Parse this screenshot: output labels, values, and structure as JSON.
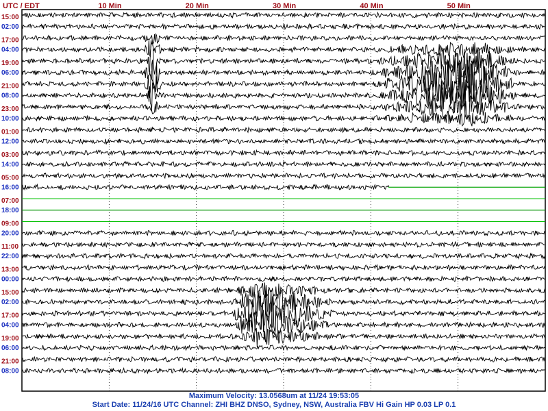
{
  "header": {
    "timezone_label": "UTC / EDT"
  },
  "footer": {
    "max_velocity": "Maximum Velocity: 13.0568um at 11/24 19:53:05",
    "start_info": "Start Date: 11/24/16 UTC Channel: ZHI  BHZ  DNSO, Sydney, NSW, Australia  FBV Hi Gain HP 0.03  LP 0.1"
  },
  "colors": {
    "utc_label": "#a0101a",
    "local_label": "#1a2fc0",
    "trace": "#000000",
    "quiet_trace": "#00c000",
    "grid": "#000000"
  },
  "chart_data": {
    "type": "line",
    "title": "",
    "xlabel": "",
    "ylabel": "",
    "x_unit": "Min",
    "xlim": [
      0,
      60
    ],
    "x_ticks": [
      {
        "value": 10,
        "label": "10 Min"
      },
      {
        "value": 20,
        "label": "20 Min"
      },
      {
        "value": 30,
        "label": "30 Min"
      },
      {
        "value": 40,
        "label": "40 Min"
      },
      {
        "value": 50,
        "label": "50 Min"
      }
    ],
    "rows_per_label": 2,
    "left_labels": [
      {
        "utc": "15:00",
        "local": "02:00"
      },
      {
        "utc": "17:00",
        "local": "04:00"
      },
      {
        "utc": "19:00",
        "local": "06:00"
      },
      {
        "utc": "21:00",
        "local": "08:00"
      },
      {
        "utc": "23:00",
        "local": "10:00"
      },
      {
        "utc": "01:00",
        "local": "12:00"
      },
      {
        "utc": "03:00",
        "local": "14:00"
      },
      {
        "utc": "05:00",
        "local": "16:00"
      },
      {
        "utc": "07:00",
        "local": "18:00"
      },
      {
        "utc": "09:00",
        "local": "20:00"
      },
      {
        "utc": "11:00",
        "local": "22:00"
      },
      {
        "utc": "13:00",
        "local": "00:00"
      },
      {
        "utc": "15:00",
        "local": "02:00"
      },
      {
        "utc": "17:00",
        "local": "04:00"
      },
      {
        "utc": "19:00",
        "local": "06:00"
      },
      {
        "utc": "21:00",
        "local": "08:00"
      }
    ],
    "quiet_traces": {
      "row_indices": [
        15,
        16,
        17,
        18
      ],
      "from_minute": [
        42,
        0,
        0,
        0
      ]
    },
    "events": [
      {
        "name": "regional-event",
        "row_start": 3,
        "row_end": 9,
        "start_min": 40,
        "peak_min": 51,
        "end_min": 57,
        "max_amp": 3.4
      },
      {
        "name": "spike-burst",
        "row_start": 2,
        "row_end": 8,
        "start_min": 14,
        "peak_min": 15,
        "end_min": 16,
        "max_amp": 4.0
      },
      {
        "name": "main-event",
        "row_start": 24,
        "row_end": 28,
        "start_min": 24,
        "peak_min": 27,
        "end_min": 36,
        "max_amp": 3.3
      }
    ]
  }
}
